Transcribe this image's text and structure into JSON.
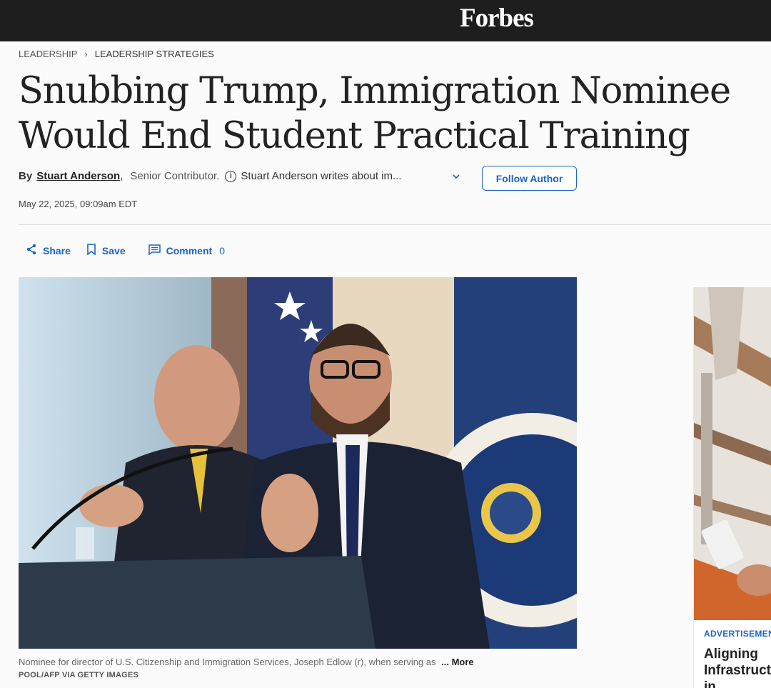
{
  "header": {
    "logo": "Forbes"
  },
  "breadcrumb": {
    "section": "LEADERSHIP",
    "subsection": "LEADERSHIP STRATEGIES"
  },
  "article": {
    "headline": "Snubbing Trump, Immigration Nominee Would End Student Practical Training",
    "by_label": "By",
    "author": "Stuart Anderson",
    "author_title": "Senior Contributor.",
    "author_about": "Stuart Anderson writes about im...",
    "follow_label": "Follow Author",
    "date": "May 22, 2025, 09:09am EDT"
  },
  "actions": {
    "share": "Share",
    "save": "Save",
    "comment": "Comment",
    "comment_count": "0"
  },
  "image": {
    "caption": "Nominee for director of U.S. Citizenship and Immigration Services, Joseph Edlow (r), when serving as",
    "caption_more": "... More",
    "credit": "POOL/AFP VIA GETTY IMAGES"
  },
  "ad": {
    "label": "ADVERTISEMENT",
    "title": "Aligning Infrastructure Growth in"
  },
  "colors": {
    "accent": "#1a64c4",
    "topbar": "#1e1e1e"
  }
}
